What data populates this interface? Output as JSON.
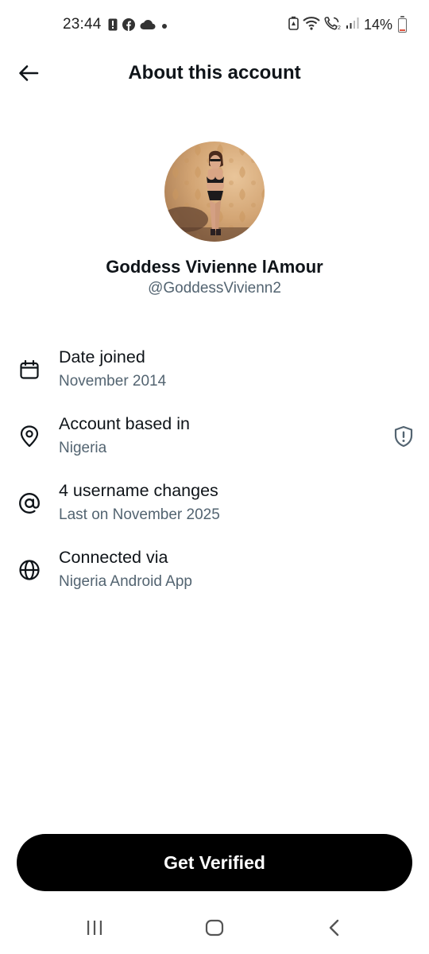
{
  "status_bar": {
    "time": "23:44",
    "battery_percent": "14%",
    "left_icons": [
      "alert-icon",
      "facebook-icon",
      "cloud-icon",
      "dot-icon"
    ],
    "right_icons": [
      "battery-saver-icon",
      "wifi-icon",
      "wifi-calling-icon",
      "signal-icon"
    ],
    "battery_level": 0.14,
    "battery_color": "#e0533f"
  },
  "header": {
    "title": "About this account",
    "back_icon": "arrow-left-icon"
  },
  "profile": {
    "display_name": "Goddess Vivienne lAmour",
    "handle": "@GoddessVivienn2"
  },
  "info_items": [
    {
      "icon": "calendar-icon",
      "label": "Date joined",
      "value": "November 2014"
    },
    {
      "icon": "location-pin-icon",
      "label": "Account based in",
      "value": "Nigeria",
      "trailing_icon": "shield-alert-icon"
    },
    {
      "icon": "at-sign-icon",
      "label": "4 username changes",
      "value": "Last on November 2025"
    },
    {
      "icon": "globe-icon",
      "label": "Connected via",
      "value": "Nigeria Android App"
    }
  ],
  "actions": {
    "verify_label": "Get Verified"
  },
  "nav_bar": {
    "icons": [
      "recents-icon",
      "home-icon",
      "back-icon"
    ]
  },
  "colors": {
    "primary_text": "#0f1419",
    "secondary_text": "#536471",
    "button_bg": "#000000",
    "button_text": "#ffffff"
  }
}
